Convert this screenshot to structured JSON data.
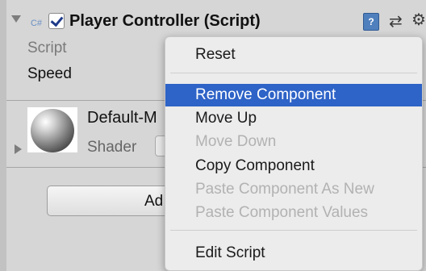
{
  "component": {
    "title": "Player Controller (Script)",
    "script_icon_text": "C#",
    "enabled": true,
    "icons": [
      "foldout-arrow-icon",
      "cs-script-icon",
      "book-help-icon",
      "preset-settings-icon",
      "gear-icon"
    ]
  },
  "fields": {
    "script_label": "Script",
    "speed_label": "Speed"
  },
  "material": {
    "name": "Default-Material",
    "name_visible": "Default-M",
    "shader_label": "Shader"
  },
  "add_component": {
    "label_visible": "Ad"
  },
  "context_menu": {
    "items": [
      {
        "label": "Reset",
        "enabled": true
      },
      {
        "label": "Remove Component",
        "enabled": true,
        "highlighted": true
      },
      {
        "label": "Move Up",
        "enabled": true
      },
      {
        "label": "Move Down",
        "enabled": false
      },
      {
        "label": "Copy Component",
        "enabled": true
      },
      {
        "label": "Paste Component As New",
        "enabled": false
      },
      {
        "label": "Paste Component Values",
        "enabled": false
      },
      {
        "label": "Edit Script",
        "enabled": true
      }
    ]
  },
  "colors": {
    "highlight": "#2e63c7",
    "disabled_text": "#b2b2b2",
    "panel_bg": "#d6d6d6",
    "menu_bg": "#ececec"
  }
}
